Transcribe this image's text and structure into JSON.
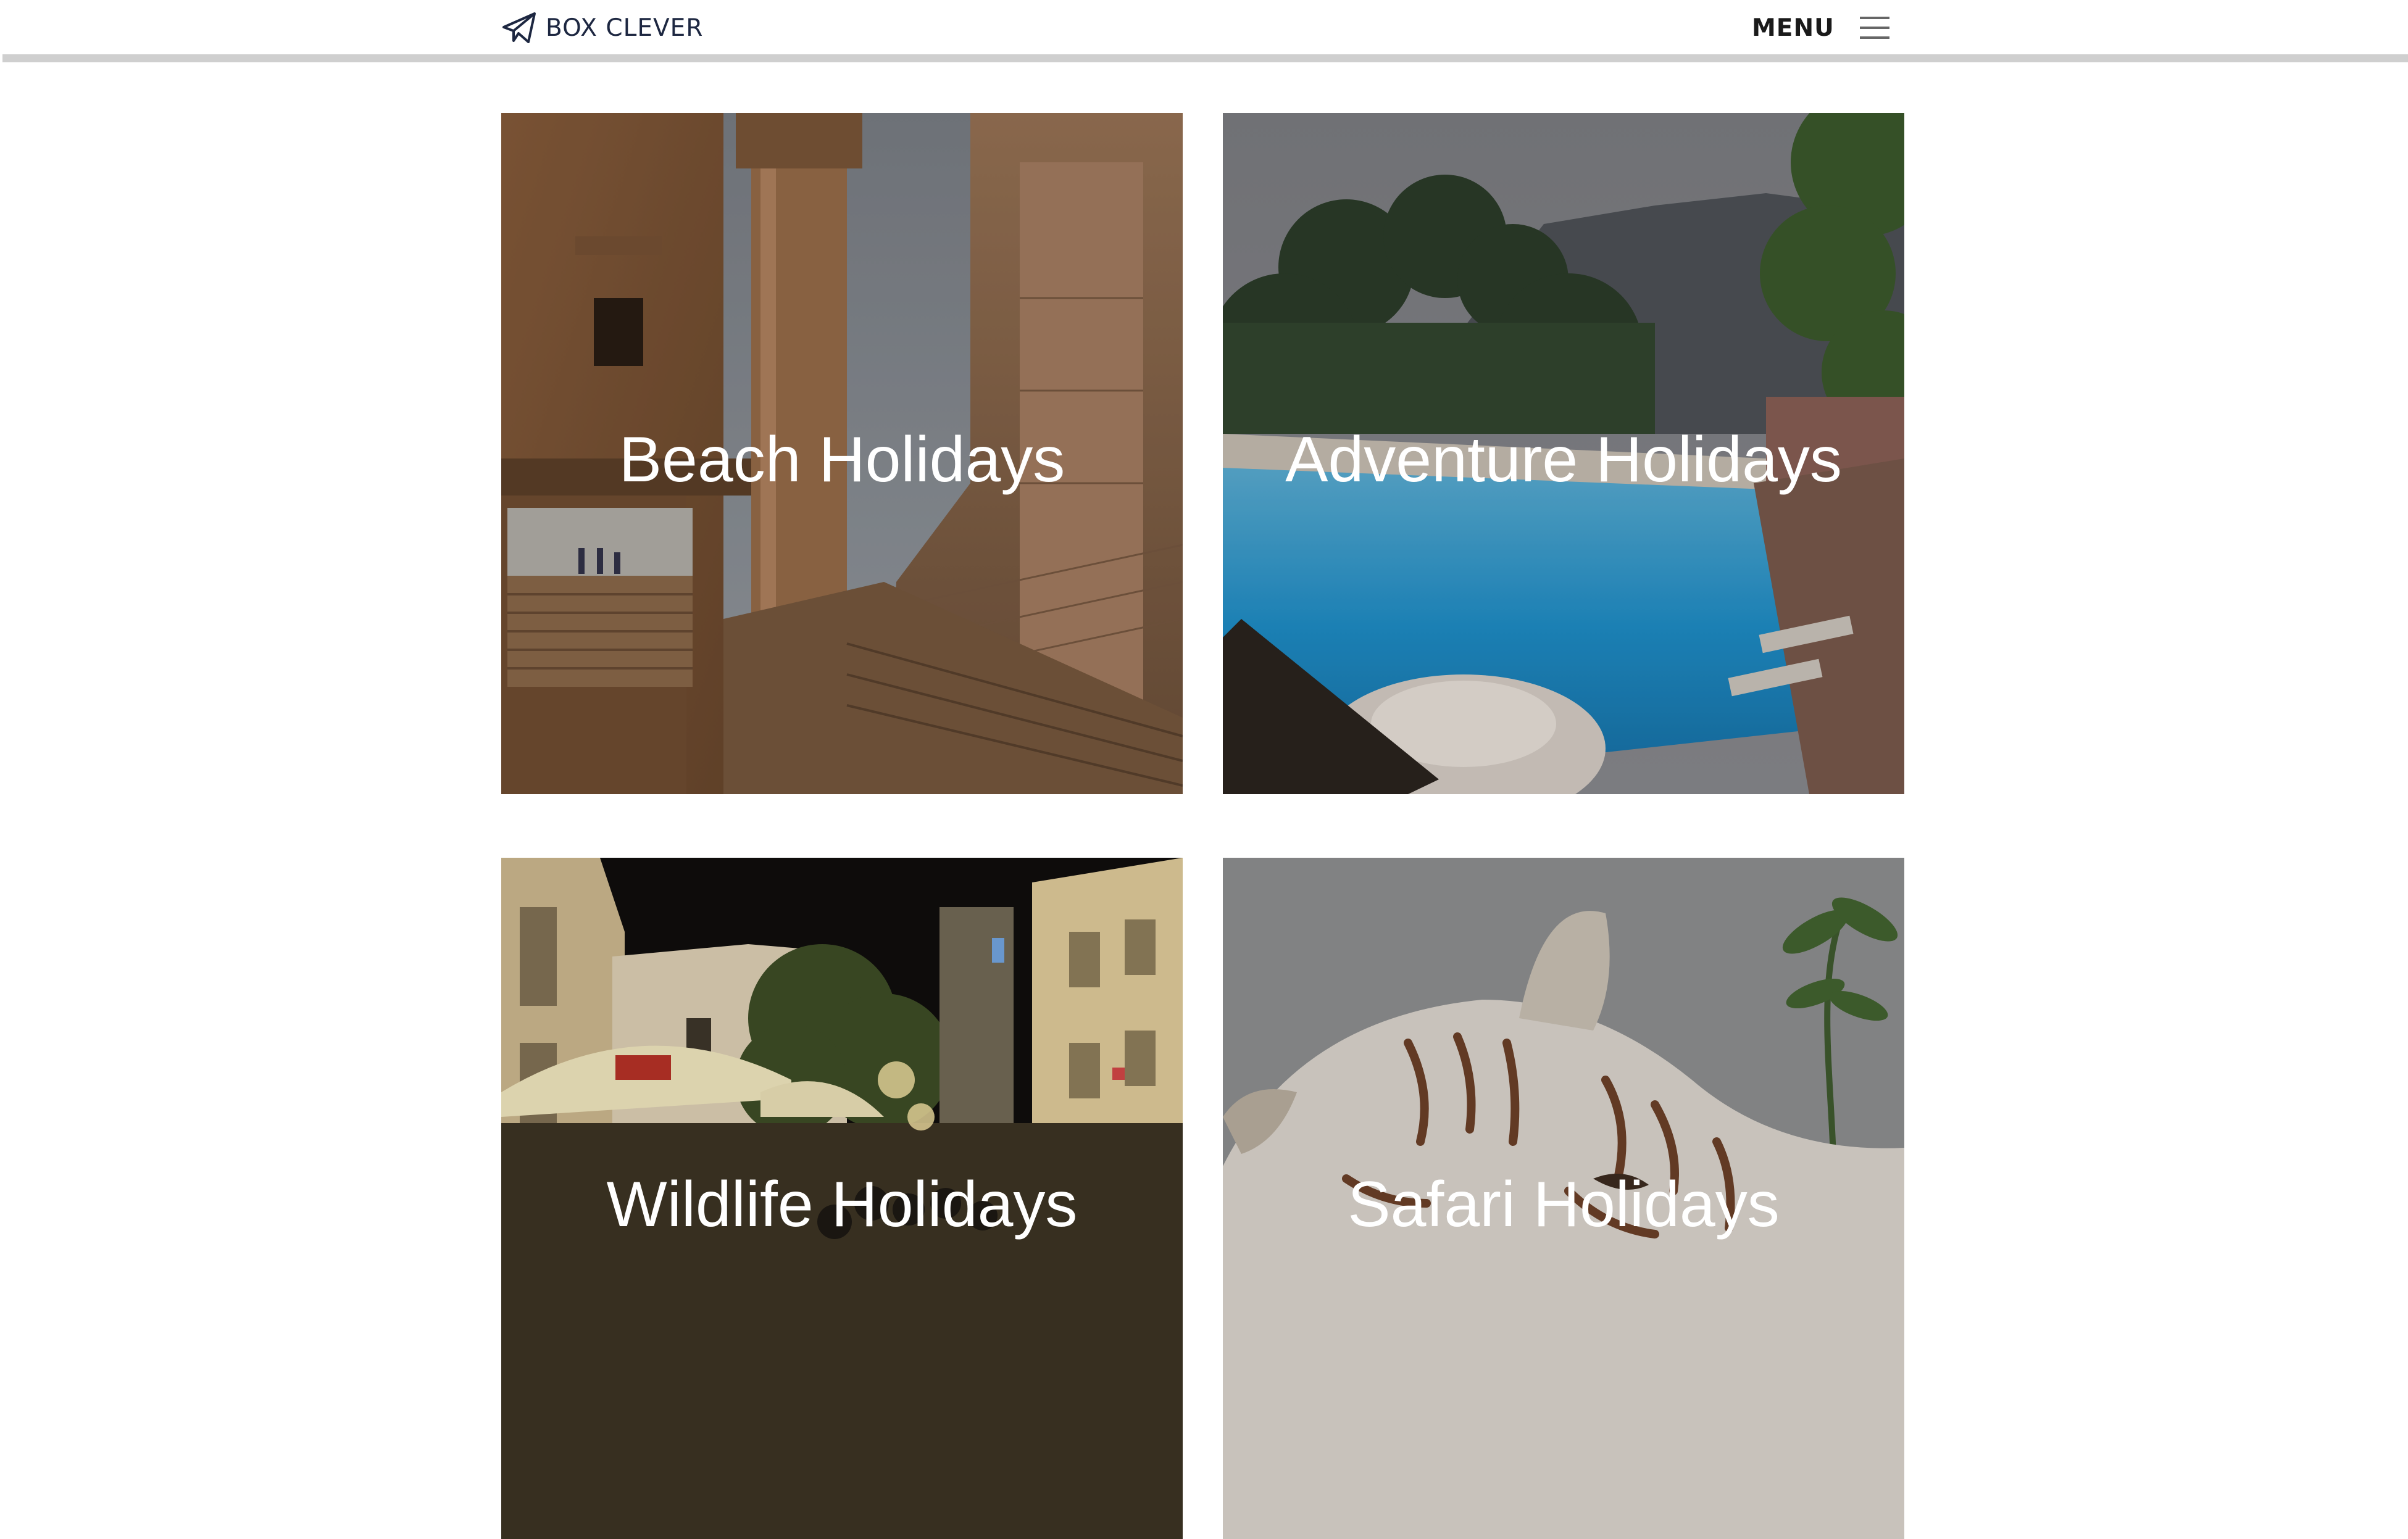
{
  "header": {
    "brand": {
      "name": "BOX CLEVER",
      "icon": "paper-plane-icon"
    },
    "menu": {
      "label": "MENU",
      "icon": "hamburger-icon"
    }
  },
  "tiles": [
    {
      "title": "Beach Holidays",
      "image": "ancient-ruins-stairs"
    },
    {
      "title": "Adventure Holidays",
      "image": "resort-infinity-pool"
    },
    {
      "title": "Wildlife Holidays",
      "image": "night-street-cafe"
    },
    {
      "title": "Safari Holidays",
      "image": "white-tiger"
    }
  ],
  "colors": {
    "header_rule": "#cfcfcf",
    "brand_text": "#1d2741",
    "tile_text": "#ffffff"
  }
}
